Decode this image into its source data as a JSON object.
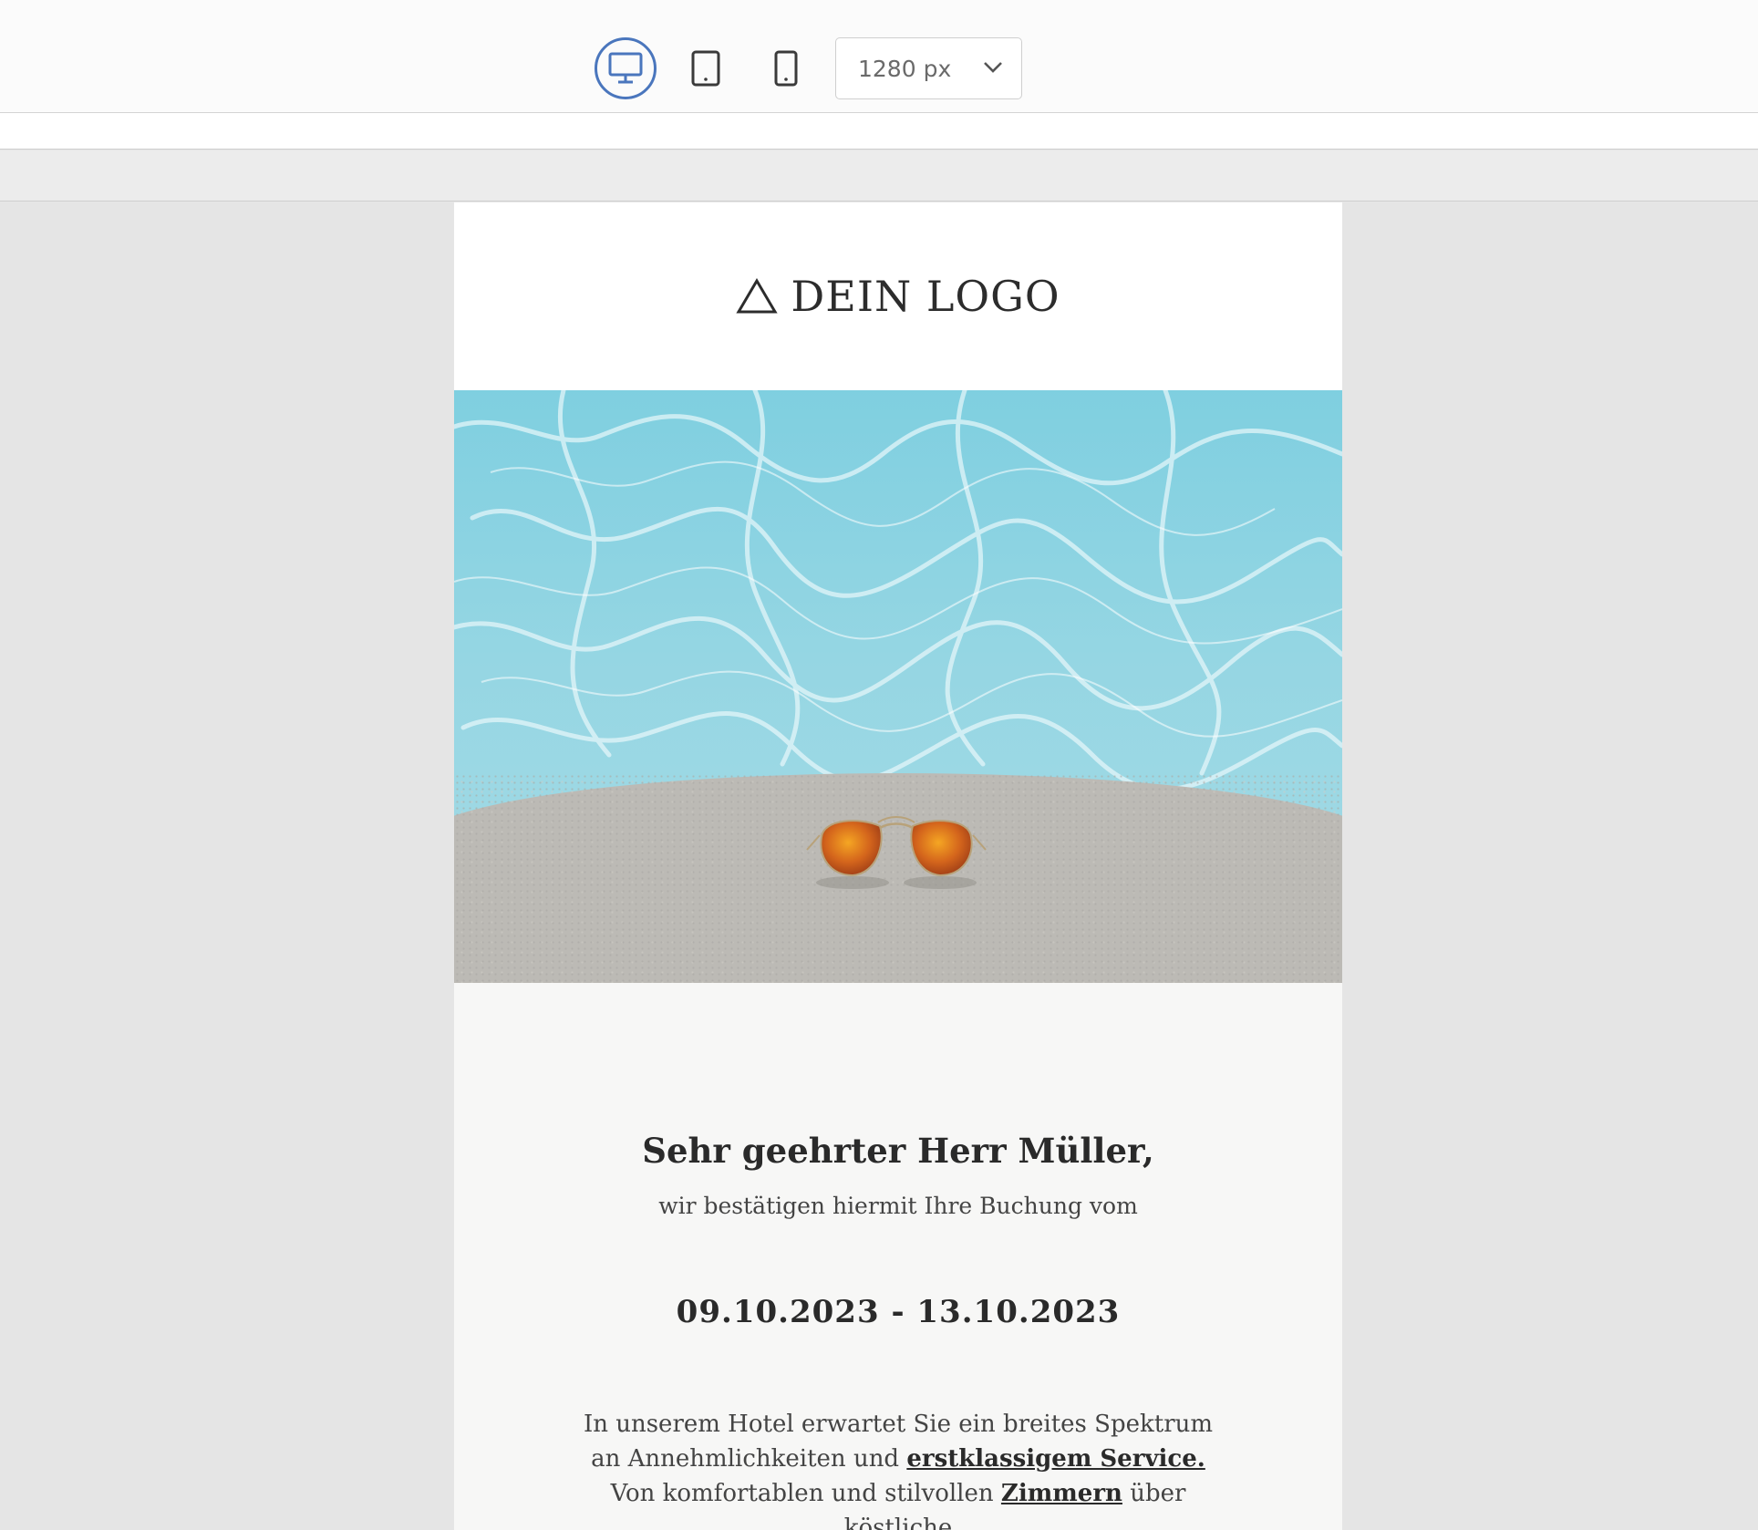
{
  "toolbar": {
    "devices": [
      {
        "name": "desktop",
        "icon": "desktop-icon",
        "active": true
      },
      {
        "name": "tablet",
        "icon": "tablet-icon",
        "active": false
      },
      {
        "name": "mobile",
        "icon": "mobile-icon",
        "active": false
      }
    ],
    "width_value": "1280 px",
    "accent_color": "#4a76bd"
  },
  "email": {
    "logo_icon": "triangle-icon",
    "logo_text": "DEIN LOGO",
    "hero_icon": "hero-image-pool-sunglasses",
    "greeting": "Sehr geehrter Herr Müller,",
    "intro": "wir bestätigen hiermit Ihre Buchung vom",
    "dates": "09.10.2023 - 13.10.2023",
    "body": {
      "part1": "In unserem Hotel erwartet Sie ein breites Spektrum an Annehmlichkeiten und",
      "link1": "erstklassigem Service.",
      "part2": "Von komfortablen und stilvollen",
      "link2": "Zimmern",
      "part3": "über köstliche"
    }
  }
}
